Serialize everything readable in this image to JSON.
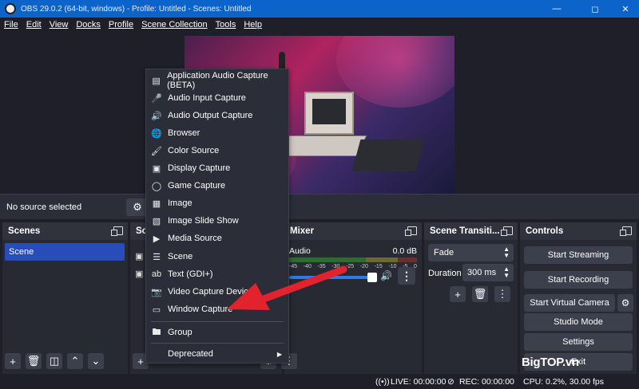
{
  "window": {
    "title": "OBS 29.0.2 (64-bit, windows) - Profile: Untitled - Scenes: Untitled",
    "minimize_icon": "minimize-icon",
    "maximize_icon": "maximize-icon",
    "close_icon": "close-icon"
  },
  "menubar": [
    "File",
    "Edit",
    "View",
    "Docks",
    "Profile",
    "Scene Collection",
    "Tools",
    "Help"
  ],
  "source_bar": {
    "status": "No source selected"
  },
  "scenes": {
    "title": "Scenes",
    "items": [
      "Scene"
    ]
  },
  "sources": {
    "title": "So"
  },
  "mixer": {
    "title": "Mixer",
    "channel": "Audio",
    "db": "0.0 dB",
    "ticks": [
      "-45",
      "-40",
      "-35",
      "-30",
      "-25",
      "-20",
      "-15",
      "-10",
      "-5",
      "0"
    ]
  },
  "transitions": {
    "title": "Scene Transiti...",
    "selected": "Fade",
    "duration_label": "Duration",
    "duration_value": "300 ms"
  },
  "controls": {
    "title": "Controls",
    "start_streaming": "Start Streaming",
    "start_recording": "Start Recording",
    "start_virtual_camera": "Start Virtual Camera",
    "studio_mode": "Studio Mode",
    "settings": "Settings",
    "exit": "Exit"
  },
  "context_menu": {
    "items": [
      {
        "label": "Application Audio Capture (BETA)",
        "icon": "app-audio-icon"
      },
      {
        "label": "Audio Input Capture",
        "icon": "microphone-icon"
      },
      {
        "label": "Audio Output Capture",
        "icon": "speaker-icon"
      },
      {
        "label": "Browser",
        "icon": "globe-icon"
      },
      {
        "label": "Color Source",
        "icon": "paintbrush-icon"
      },
      {
        "label": "Display Capture",
        "icon": "monitor-icon"
      },
      {
        "label": "Game Capture",
        "icon": "gamepad-icon"
      },
      {
        "label": "Image",
        "icon": "image-icon"
      },
      {
        "label": "Image Slide Show",
        "icon": "slideshow-icon"
      },
      {
        "label": "Media Source",
        "icon": "play-icon"
      },
      {
        "label": "Scene",
        "icon": "list-icon"
      },
      {
        "label": "Text (GDI+)",
        "icon": "text-icon"
      },
      {
        "label": "Video Capture Device",
        "icon": "camera-icon"
      },
      {
        "label": "Window Capture",
        "icon": "window-icon"
      }
    ],
    "group": "Group",
    "deprecated": "Deprecated"
  },
  "status": {
    "live": "LIVE: 00:00:00",
    "rec": "REC: 00:00:00",
    "cpu": "CPU: 0.2%, 30.00 fps"
  },
  "watermark": "BigTOP.vn",
  "colors": {
    "titlebar": "#0c63c9",
    "selected_scene": "#284cb8",
    "arrow": "#e2232e"
  }
}
